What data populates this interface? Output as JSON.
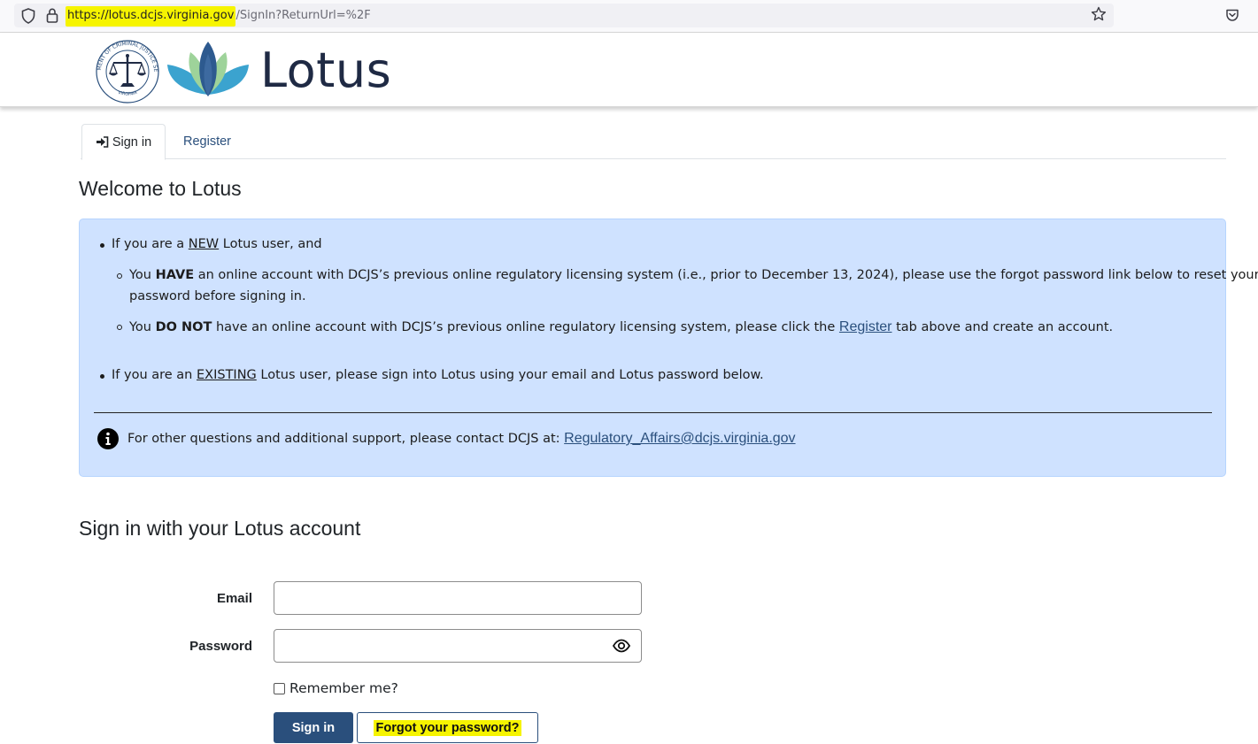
{
  "browser": {
    "url_highlight": "https://lotus.dcjs.virginia.gov",
    "url_rest": "/SignIn?ReturnUrl=%2F",
    "highlight_color": "#f6f400"
  },
  "header": {
    "brand": "Lotus",
    "seal_top_text": "DEPARTMENT OF CRIMINAL JUSTICE SERVICES",
    "seal_bottom_text": "VIRGINIA"
  },
  "tabs": [
    {
      "label": "Sign in",
      "active": true
    },
    {
      "label": "Register",
      "active": false
    }
  ],
  "welcome": {
    "title": "Welcome to Lotus"
  },
  "info": {
    "new_user_prefix": "If you are a ",
    "new_user_em": "NEW",
    "new_user_suffix": " Lotus user, and",
    "have_prefix": "You ",
    "have_em": "HAVE",
    "have_line1": " an online account with DCJS’s previous online regulatory licensing system (i.e., prior to December 13, 2024), please use the forgot password link below to reset your",
    "have_line2": "password before signing in.",
    "donot_prefix": "You ",
    "donot_em": "DO NOT",
    "donot_middle": " have an online account with DCJS’s previous online regulatory licensing system, please click the ",
    "donot_link": "Register",
    "donot_suffix": " tab above and create an account.",
    "existing_prefix": "If you are an ",
    "existing_em": "EXISTING",
    "existing_suffix": " Lotus user, please sign into Lotus using your email and Lotus password below.",
    "contact_text": "For other questions and additional support, please contact DCJS at: ",
    "contact_email": "Regulatory_Affairs@dcjs.virginia.gov"
  },
  "signin": {
    "title": "Sign in with your Lotus account",
    "email_label": "Email",
    "email_value": "",
    "password_label": "Password",
    "password_value": "",
    "remember_label": "Remember me?",
    "remember_checked": false,
    "submit_label": "Sign in",
    "forgot_label": "Forgot your password?"
  },
  "colors": {
    "primary": "#2a4f7c",
    "info_bg": "#cfe2ff",
    "brand_text": "#1f2a44"
  }
}
